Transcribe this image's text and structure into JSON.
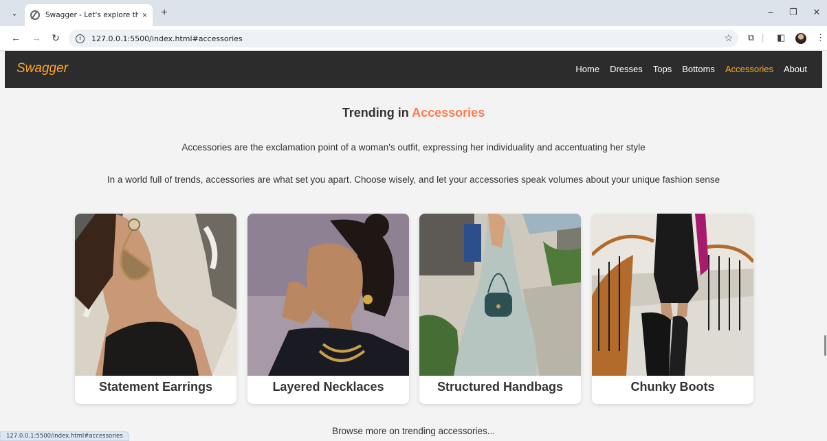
{
  "browser": {
    "tab_title": "Swagger - Let's explore the tre",
    "tab_close": "×",
    "new_tab": "+",
    "url": "127.0.0.1:5500/index.html#accessories",
    "status_url": "127.0.0.1:5500/index.html#accessories"
  },
  "site": {
    "brand": "Swagger",
    "nav": [
      {
        "label": "Home",
        "active": false
      },
      {
        "label": "Dresses",
        "active": false
      },
      {
        "label": "Tops",
        "active": false
      },
      {
        "label": "Bottoms",
        "active": false
      },
      {
        "label": "Accessories",
        "active": true
      },
      {
        "label": "About",
        "active": false
      }
    ],
    "accent_color": "#ffa726",
    "nav_bg": "#2c2c2c"
  },
  "section": {
    "heading_prefix": "Trending in ",
    "heading_accent": "Accessories",
    "heading_accent_color": "#ff7b4a",
    "para1": "Accessories are the exclamation point of a woman's outfit, expressing her individuality and accentuating her style",
    "para2": "In a world full of trends, accessories are what set you apart. Choose wisely, and let your accessories speak volumes about your unique fashion sense",
    "cards": [
      {
        "label": "Statement Earrings"
      },
      {
        "label": "Layered Necklaces"
      },
      {
        "label": "Structured Handbags"
      },
      {
        "label": "Chunky Boots"
      }
    ],
    "browse_more": "Browse more on trending accessories..."
  }
}
